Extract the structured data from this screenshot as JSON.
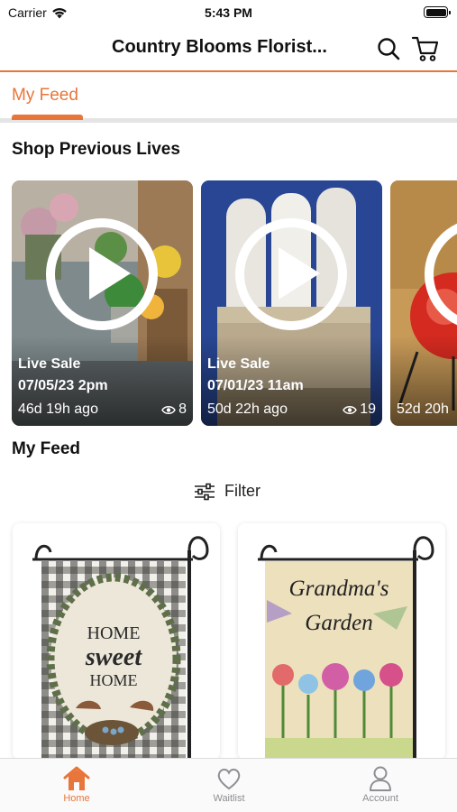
{
  "status_bar": {
    "carrier": "Carrier",
    "time": "5:43 PM"
  },
  "header": {
    "title": "Country Blooms Florist..."
  },
  "tabs": [
    {
      "label": "My Feed",
      "active": true
    }
  ],
  "previous_lives": {
    "title": "Shop Previous Lives",
    "items": [
      {
        "label": "Live Sale",
        "date": "07/05/23 2pm",
        "ago": "46d 19h ago",
        "views": "8"
      },
      {
        "label": "Live Sale",
        "date": "07/01/23 11am",
        "ago": "50d 22h ago",
        "views": "19"
      },
      {
        "label": "",
        "date": "",
        "ago": "52d 20h",
        "views": ""
      }
    ]
  },
  "feed": {
    "title": "My Feed",
    "filter_label": "Filter",
    "products": [
      {
        "flag_text_1": "HOME",
        "flag_text_2": "sweet",
        "flag_text_3": "HOME"
      },
      {
        "flag_text_1": "Grandma's",
        "flag_text_2": "Garden"
      }
    ]
  },
  "bottom_nav": {
    "items": [
      {
        "label": "Home",
        "icon": "home-icon",
        "active": true
      },
      {
        "label": "Waitlist",
        "icon": "heart-icon",
        "active": false
      },
      {
        "label": "Account",
        "icon": "person-icon",
        "active": false
      }
    ]
  },
  "colors": {
    "accent": "#e8763a",
    "inactive": "#8e8e93",
    "divider": "#e4e4e4"
  }
}
